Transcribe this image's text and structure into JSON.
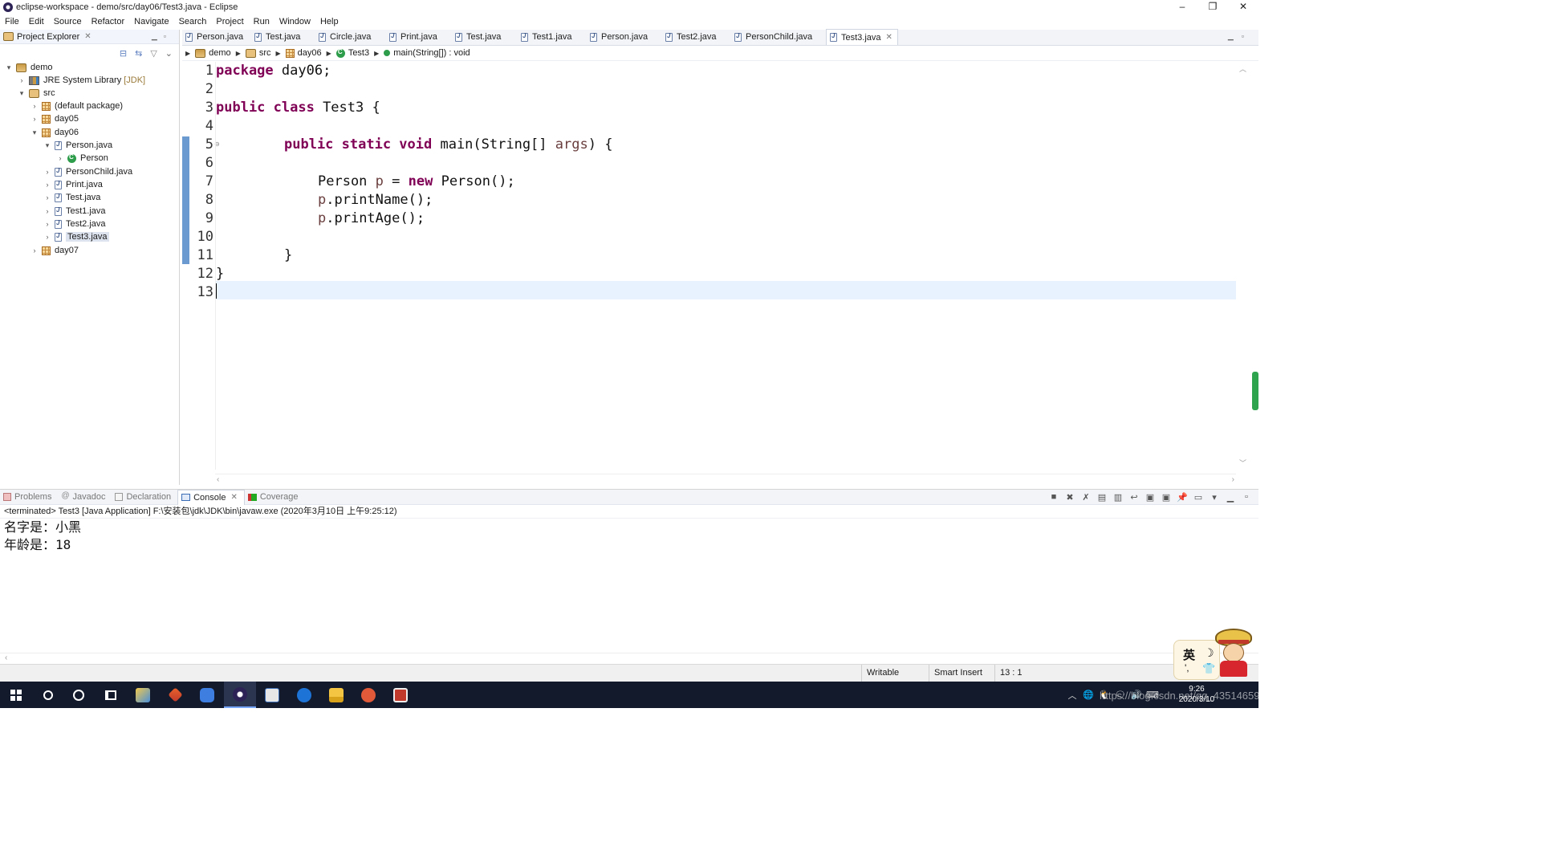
{
  "window": {
    "title": "eclipse-workspace - demo/src/day06/Test3.java - Eclipse",
    "controls": [
      "–",
      "❐",
      "✕"
    ]
  },
  "menu": [
    "File",
    "Edit",
    "Source",
    "Refactor",
    "Navigate",
    "Search",
    "Project",
    "Run",
    "Window",
    "Help"
  ],
  "explorer": {
    "title": "Project Explorer",
    "tree": {
      "demo": "demo",
      "jre": "JRE System Library",
      "jre_suffix": "[JDK]",
      "src": "src",
      "default_pkg": "(default package)",
      "day05": "day05",
      "day06": "day06",
      "person_java": "Person.java",
      "person_class": "Person",
      "personchild_java": "PersonChild.java",
      "print_java": "Print.java",
      "test_java": "Test.java",
      "test1_java": "Test1.java",
      "test2_java": "Test2.java",
      "test3_java": "Test3.java",
      "day07": "day07"
    }
  },
  "editor": {
    "tabs": [
      "Person.java",
      "Test.java",
      "Circle.java",
      "Print.java",
      "Test.java",
      "Test1.java",
      "Person.java",
      "Test2.java",
      "PersonChild.java",
      "Test3.java"
    ],
    "active_tab": "Test3.java",
    "breadcrumb": [
      "demo",
      "src",
      "day06",
      "Test3",
      "main(String[]) : void"
    ],
    "line_numbers": [
      "1",
      "2",
      "3",
      "4",
      "5",
      "6",
      "7",
      "8",
      "9",
      "10",
      "11",
      "12",
      "13"
    ],
    "code": {
      "l1_kw": "package",
      "l1_rest": " day06;",
      "l3_kw": "public class",
      "l3_rest": " Test3 {",
      "l5_kw": "public static void",
      "l5_mid": " main(String[] ",
      "l5_var": "args",
      "l5_end": ") {",
      "l7_a": "Person ",
      "l7_var": "p",
      "l7_b": " = ",
      "l7_kw": "new",
      "l7_c": " Person();",
      "l8_var": "p",
      "l8_rest": ".printName();",
      "l9_var": "p",
      "l9_rest": ".printAge();",
      "l11": "}",
      "l12": "}"
    },
    "highlight_color": "#e8f2fe",
    "keyword_color": "#7f0055"
  },
  "console": {
    "tabs": {
      "problems": "Problems",
      "javadoc": "Javadoc",
      "declaration": "Declaration",
      "console": "Console",
      "coverage": "Coverage"
    },
    "status": "<terminated> Test3 [Java Application] F:\\安装包\\jdk\\JDK\\bin\\javaw.exe (2020年3月10日 上午9:25:12)",
    "output": {
      "name_label": "名字是：",
      "name_value": "小黑",
      "age_label": "年龄是：",
      "age_value": "18"
    }
  },
  "statusbar": {
    "writable": "Writable",
    "insert_mode": "Smart Insert",
    "position": "13 : 1"
  },
  "ime": {
    "lang": "英",
    "moon": "☽",
    "punct": "',",
    "skin": "👕"
  },
  "taskbar": {
    "tray_icons": [
      "︿",
      "🌐",
      "🐧",
      "🗨",
      "🔊",
      "⌨"
    ],
    "time": "9:26",
    "date": "2020/3/10",
    "watermark": "https://blog.csdn.net/qq_43514659"
  }
}
